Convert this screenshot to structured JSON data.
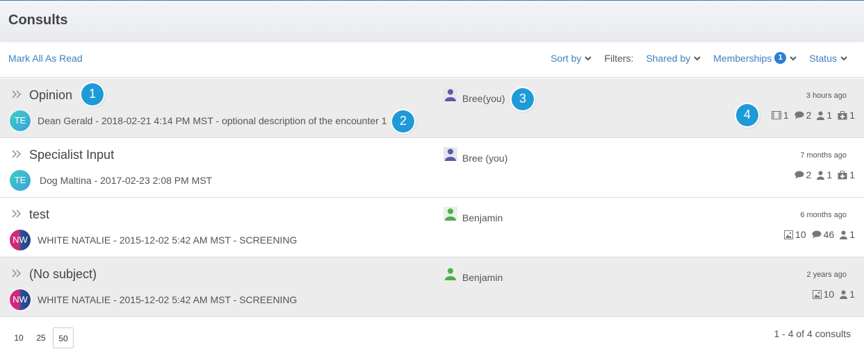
{
  "header": {
    "title": "Consults"
  },
  "toolbar": {
    "mark_all_read": "Mark All As Read",
    "sort_by": "Sort by",
    "filters_label": "Filters:",
    "shared_by": "Shared by",
    "memberships": "Memberships",
    "memberships_count": "1",
    "status": "Status"
  },
  "consults": [
    {
      "subject": "Opinion",
      "avatar": "TE",
      "description": "Dean Gerald - 2018-02-21 4:14 PM MST - optional description of the encounter 1",
      "owner": "Bree",
      "owner_suffix": "(you)",
      "time": "3 hours ago",
      "stats": {
        "video": "1",
        "comments": "2",
        "members": "1",
        "cases": "1"
      }
    },
    {
      "subject": "Specialist Input",
      "avatar": "TE",
      "description": "Dog Maltina - 2017-02-23 2:08 PM MST",
      "owner": "Bree",
      "owner_suffix": "(you)",
      "time": "7 months ago",
      "stats": {
        "comments": "2",
        "members": "1",
        "cases": "1"
      }
    },
    {
      "subject": "test",
      "avatar": "NW",
      "description": "WHITE NATALIE - 2015-12-02 5:42 AM MST - SCREENING",
      "owner": "Benjamin",
      "time": "6 months ago",
      "stats": {
        "images": "10",
        "comments": "46",
        "members": "1"
      }
    },
    {
      "subject": "(No subject)",
      "avatar": "NW",
      "description": "WHITE NATALIE - 2015-12-02 5:42 AM MST - SCREENING",
      "owner": "Benjamin",
      "time": "2 years ago",
      "stats": {
        "images": "10",
        "members": "1"
      }
    }
  ],
  "callouts": [
    "1",
    "2",
    "3",
    "4"
  ],
  "pagination": {
    "sizes": [
      "10",
      "25",
      "50"
    ],
    "active": "50",
    "summary": "1 - 4 of 4 consults"
  },
  "colors": {
    "accent": "#3c7fc2",
    "callout": "#1e9bd7",
    "owner_self": "#5c5aa6",
    "owner_other": "#4cae4c"
  }
}
